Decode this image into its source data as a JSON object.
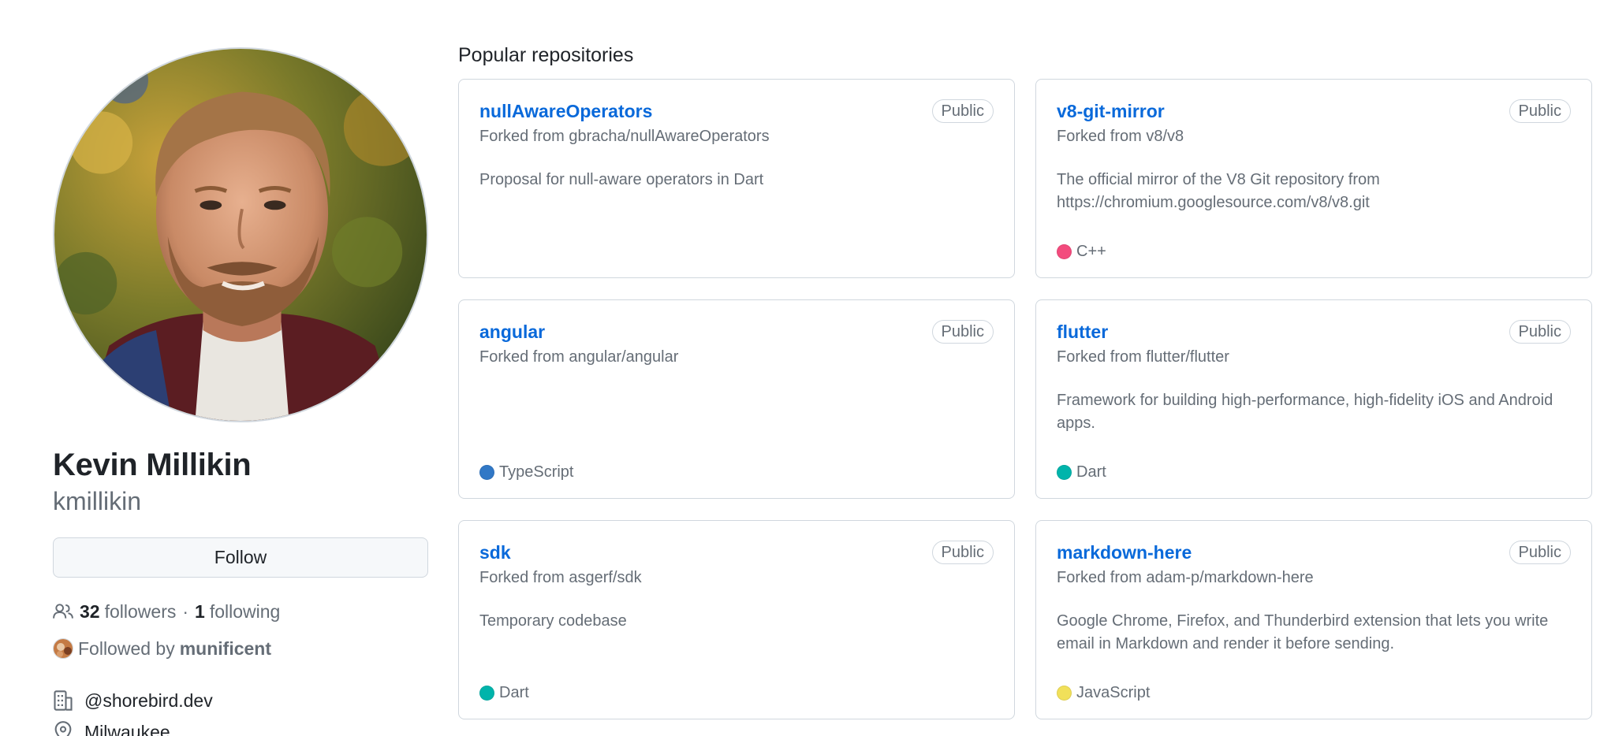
{
  "profile": {
    "name": "Kevin Millikin",
    "login": "kmillikin",
    "follow_label": "Follow",
    "followers_count": "32",
    "followers_label": "followers",
    "separator": "·",
    "following_count": "1",
    "following_label": "following",
    "followed_by_prefix": "Followed by",
    "followed_by_user": "munificent",
    "company": "@shorebird.dev",
    "location": "Milwaukee"
  },
  "popular": {
    "title": "Popular repositories",
    "repos": [
      {
        "name": "nullAwareOperators",
        "visibility": "Public",
        "forked_from": "Forked from gbracha/nullAwareOperators",
        "description": "Proposal for null-aware operators in Dart",
        "language": "",
        "language_color": ""
      },
      {
        "name": "v8-git-mirror",
        "visibility": "Public",
        "forked_from": "Forked from v8/v8",
        "description": "The official mirror of the V8 Git repository from https://chromium.googlesource.com/v8/v8.git",
        "language": "C++",
        "language_color": "#f34b7d"
      },
      {
        "name": "angular",
        "visibility": "Public",
        "forked_from": "Forked from angular/angular",
        "description": "",
        "language": "TypeScript",
        "language_color": "#3178c6"
      },
      {
        "name": "flutter",
        "visibility": "Public",
        "forked_from": "Forked from flutter/flutter",
        "description": "Framework for building high-performance, high-fidelity iOS and Android apps.",
        "language": "Dart",
        "language_color": "#00B4AB"
      },
      {
        "name": "sdk",
        "visibility": "Public",
        "forked_from": "Forked from asgerf/sdk",
        "description": "Temporary codebase",
        "language": "Dart",
        "language_color": "#00B4AB"
      },
      {
        "name": "markdown-here",
        "visibility": "Public",
        "forked_from": "Forked from adam-p/markdown-here",
        "description": "Google Chrome, Firefox, and Thunderbird extension that lets you write email in Markdown and render it before sending.",
        "language": "JavaScript",
        "language_color": "#f1e05a"
      }
    ]
  },
  "icons": {
    "people": "people-icon",
    "building": "organization-icon",
    "location": "location-icon"
  }
}
